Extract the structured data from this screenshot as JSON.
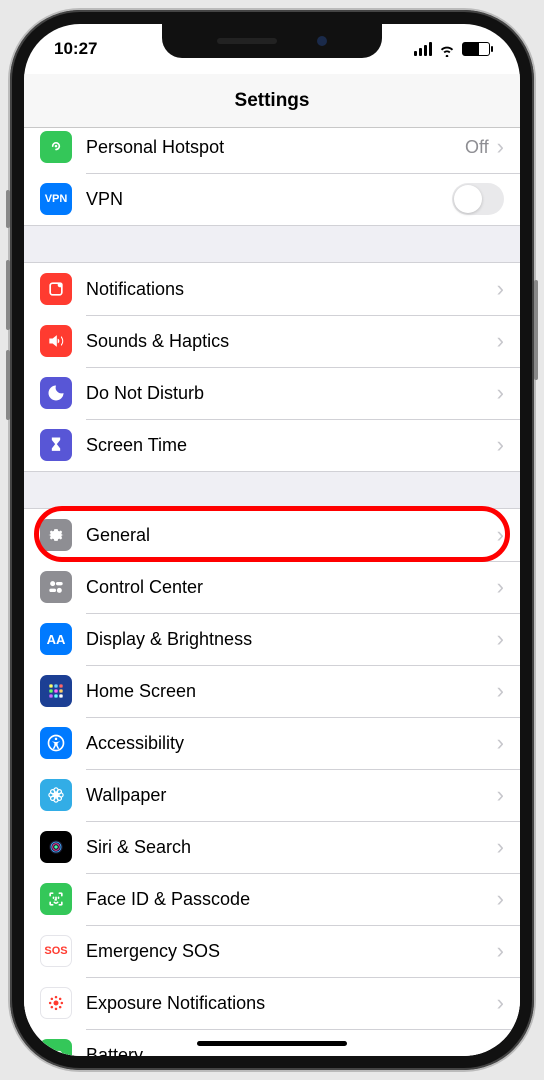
{
  "status": {
    "time": "10:27"
  },
  "nav": {
    "title": "Settings"
  },
  "rows": {
    "hotspot": {
      "label": "Personal Hotspot",
      "value": "Off"
    },
    "vpn": {
      "label": "VPN",
      "iconText": "VPN"
    },
    "notifications": {
      "label": "Notifications"
    },
    "sounds": {
      "label": "Sounds & Haptics"
    },
    "dnd": {
      "label": "Do Not Disturb"
    },
    "screentime": {
      "label": "Screen Time"
    },
    "general": {
      "label": "General"
    },
    "controlcenter": {
      "label": "Control Center"
    },
    "display": {
      "label": "Display & Brightness",
      "iconText": "AA"
    },
    "homescreen": {
      "label": "Home Screen"
    },
    "accessibility": {
      "label": "Accessibility"
    },
    "wallpaper": {
      "label": "Wallpaper"
    },
    "siri": {
      "label": "Siri & Search"
    },
    "faceid": {
      "label": "Face ID & Passcode"
    },
    "sos": {
      "label": "Emergency SOS",
      "iconText": "SOS"
    },
    "exposure": {
      "label": "Exposure Notifications"
    },
    "battery": {
      "label": "Battery"
    }
  },
  "highlighted_row": "general"
}
